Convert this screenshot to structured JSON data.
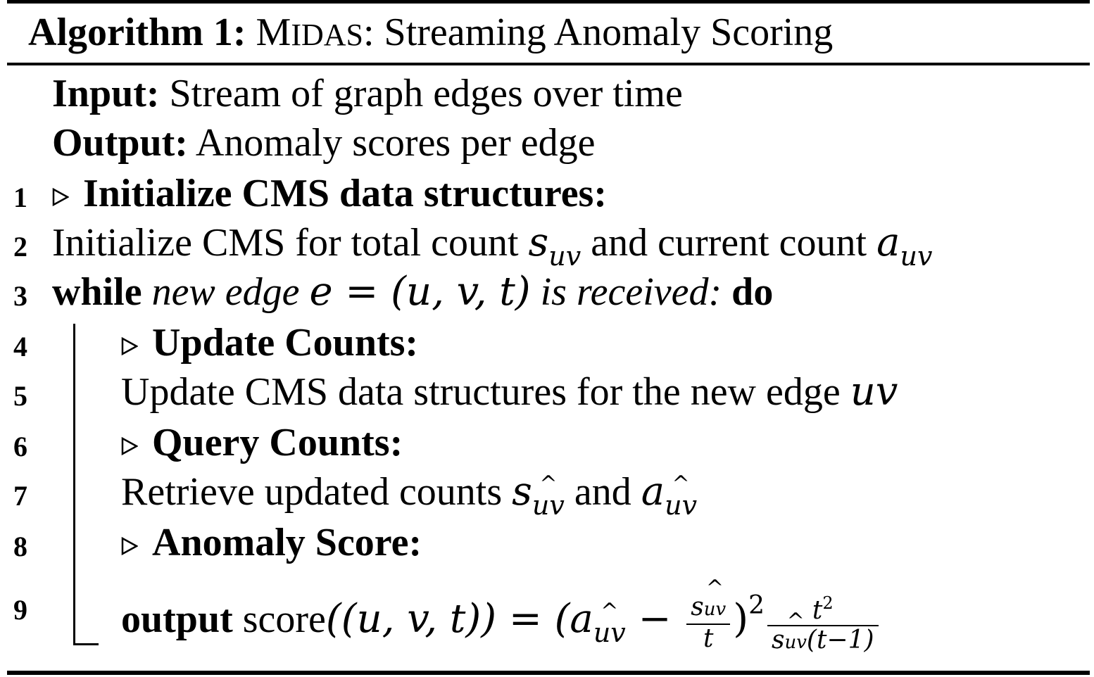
{
  "algorithm": {
    "label": "Algorithm 1:",
    "name_first": "M",
    "name_rest": "IDAS",
    "title_rest": ": Streaming Anomaly Scoring"
  },
  "input": {
    "head": "Input:",
    "text": "Stream of graph edges over time"
  },
  "output": {
    "head": "Output:",
    "text": "Anomaly scores per edge"
  },
  "lines": [
    {
      "no": "1",
      "comment": "Initialize CMS data structures:"
    },
    {
      "no": "2",
      "text_a": "Initialize CMS for total count ",
      "var1": "s",
      "sub1": "uv",
      "text_b": " and current count ",
      "var2": "a",
      "sub2": "uv"
    },
    {
      "no": "3",
      "kw_while": "while",
      "cond_a": " new edge ",
      "cond_math": "e = (u, v, t)",
      "cond_b": " is received:",
      "kw_do": "do"
    },
    {
      "no": "4",
      "comment": "Update Counts:"
    },
    {
      "no": "5",
      "text": "Update CMS data structures for the new edge ",
      "var": "uv"
    },
    {
      "no": "6",
      "comment": "Query Counts:"
    },
    {
      "no": "7",
      "text_a": "Retrieve updated counts ",
      "var1": "s",
      "sub1": "uv",
      "text_b": " and ",
      "var2": "a",
      "sub2": "uv"
    },
    {
      "no": "8",
      "comment": "Anomaly Score:"
    },
    {
      "no": "9",
      "kw_output": "output",
      "fn": " score",
      "args": "((u, v, t)) = (",
      "a": "a",
      "a_sub": "uv",
      "minus": " − ",
      "frac1_num_var": "s",
      "frac1_num_sub": "uv",
      "frac1_den": "t",
      "close": ")",
      "sq": "2",
      "frac2_num": "t",
      "frac2_num_sup": "2",
      "frac2_den_var": "s",
      "frac2_den_sub": "uv",
      "frac2_den_rest": "(t−1)"
    }
  ]
}
